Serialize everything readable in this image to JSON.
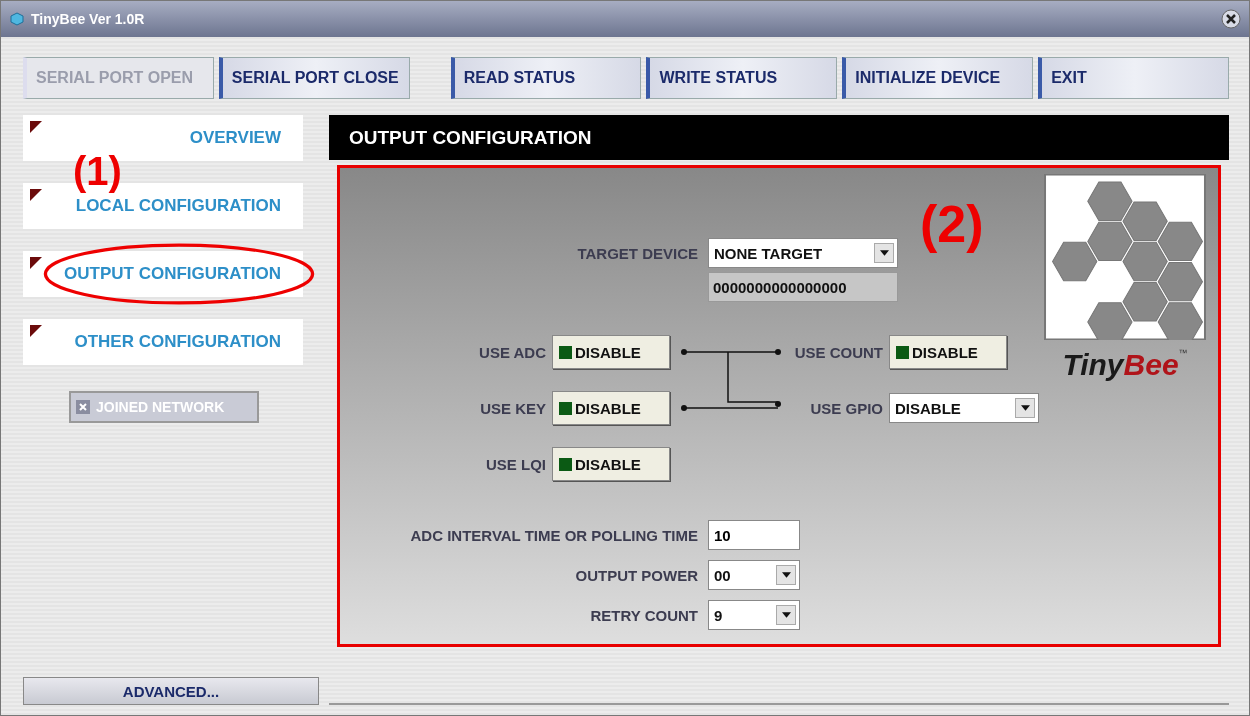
{
  "window": {
    "title": "TinyBee Ver 1.0R"
  },
  "toolbar": [
    {
      "label": "SERIAL PORT OPEN",
      "disabled": true
    },
    {
      "label": "SERIAL PORT CLOSE",
      "disabled": false
    },
    {
      "label": "READ STATUS",
      "disabled": false
    },
    {
      "label": "WRITE STATUS",
      "disabled": false
    },
    {
      "label": "INITIALIZE DEVICE",
      "disabled": false
    },
    {
      "label": "EXIT",
      "disabled": false
    }
  ],
  "sidebar": {
    "items": [
      {
        "label": "OVERVIEW"
      },
      {
        "label": "LOCAL CONFIGURATION"
      },
      {
        "label": "OUTPUT CONFIGURATION",
        "circled": true
      },
      {
        "label": "OTHER CONFIGURATION"
      }
    ],
    "joined_network": {
      "label": "JOINED NETWORK",
      "checked": true,
      "disabled": true
    },
    "advanced_button": "ADVANCED..."
  },
  "panel": {
    "title": "OUTPUT CONFIGURATION",
    "target_device": {
      "label": "TARGET DEVICE",
      "value": "NONE TARGET",
      "address": "0000000000000000"
    },
    "options": [
      {
        "label": "USE ADC",
        "kind": "toggle",
        "value": "DISABLE"
      },
      {
        "label": "USE COUNT",
        "kind": "toggle",
        "value": "DISABLE"
      },
      {
        "label": "USE KEY",
        "kind": "toggle",
        "value": "DISABLE"
      },
      {
        "label": "USE GPIO",
        "kind": "select",
        "value": "DISABLE"
      },
      {
        "label": "USE LQI",
        "kind": "toggle",
        "value": "DISABLE"
      }
    ],
    "settings": [
      {
        "label": "ADC INTERVAL TIME OR POLLING TIME",
        "kind": "input",
        "value": "10"
      },
      {
        "label": "OUTPUT POWER",
        "kind": "select",
        "value": "00"
      },
      {
        "label": "RETRY COUNT",
        "kind": "select",
        "value": "9"
      }
    ],
    "logo": {
      "word_1": "Tiny",
      "word_2": "Bee",
      "mark": "™"
    }
  },
  "annotations": [
    "(1)",
    "(2)"
  ]
}
